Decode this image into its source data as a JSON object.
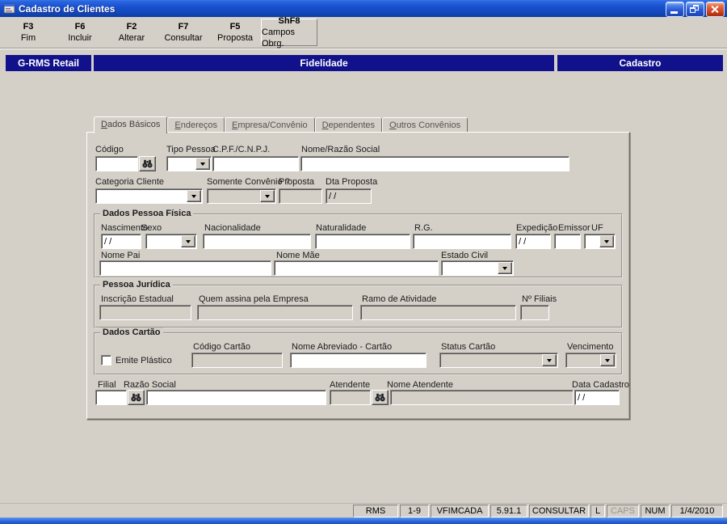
{
  "window": {
    "title": "Cadastro de Clientes"
  },
  "toolbar": {
    "buttons": [
      {
        "key": "F3",
        "label": "Fim"
      },
      {
        "key": "F6",
        "label": "Incluir"
      },
      {
        "key": "F2",
        "label": "Alterar"
      },
      {
        "key": "F7",
        "label": "Consultar"
      },
      {
        "key": "F5",
        "label": "Proposta"
      },
      {
        "key": "ShF8",
        "label": "Campos Obrg."
      }
    ]
  },
  "banner": {
    "left": "G-RMS Retail",
    "center": "Fidelidade",
    "right": "Cadastro"
  },
  "tabs": {
    "items": [
      {
        "label": "Dados Básicos"
      },
      {
        "label": "Endereços"
      },
      {
        "label": "Empresa/Convênio"
      },
      {
        "label": "Dependentes"
      },
      {
        "label": "Outros Convênios"
      }
    ]
  },
  "form": {
    "codigo": {
      "label": "Código",
      "value": ""
    },
    "tipo_pessoa": {
      "label": "Tipo Pessoa",
      "value": ""
    },
    "cpf_cnpj": {
      "label": "C.P.F./C.N.P.J.",
      "value": ""
    },
    "nome_razao_social": {
      "label": "Nome/Razão Social",
      "value": ""
    },
    "categoria_cliente": {
      "label": "Categoria Cliente",
      "value": ""
    },
    "somente_convenio": {
      "label": "Somente Convênio ?",
      "value": ""
    },
    "proposta": {
      "label": "Proposta",
      "value": ""
    },
    "dta_proposta": {
      "label": "Dta Proposta",
      "value": "/ /"
    },
    "pessoa_fisica": {
      "title": "Dados Pessoa Física",
      "nascimento": {
        "label": "Nascimento",
        "value": "/ /"
      },
      "sexo": {
        "label": "Sexo",
        "value": ""
      },
      "nacionalidade": {
        "label": "Nacionalidade",
        "value": ""
      },
      "naturalidade": {
        "label": "Naturalidade",
        "value": ""
      },
      "rg": {
        "label": "R.G.",
        "value": ""
      },
      "expedicao": {
        "label": "Expedição",
        "value": "/ /"
      },
      "emissor": {
        "label": "Emissor",
        "value": ""
      },
      "uf": {
        "label": "UF",
        "value": ""
      },
      "nome_pai": {
        "label": "Nome Pai",
        "value": ""
      },
      "nome_mae": {
        "label": "Nome Mãe",
        "value": ""
      },
      "estado_civil": {
        "label": "Estado Civil",
        "value": ""
      }
    },
    "pessoa_juridica": {
      "title": "Pessoa Jurídica",
      "inscricao_estadual": {
        "label": "Inscrição Estadual",
        "value": ""
      },
      "quem_assina": {
        "label": "Quem assina pela Empresa",
        "value": ""
      },
      "ramo_atividade": {
        "label": "Ramo de Atividade",
        "value": ""
      },
      "num_filiais": {
        "label": "Nº Filiais",
        "value": ""
      }
    },
    "cartao": {
      "title": "Dados Cartão",
      "emite_plastico": {
        "label": "Emite Plástico"
      },
      "codigo_cartao": {
        "label": "Código Cartão",
        "value": ""
      },
      "nome_abreviado": {
        "label": "Nome Abreviado - Cartão",
        "value": ""
      },
      "status_cartao": {
        "label": "Status Cartão",
        "value": ""
      },
      "vencimento": {
        "label": "Vencimento",
        "value": ""
      }
    },
    "rodape": {
      "filial": {
        "label": "Filial",
        "value": ""
      },
      "razao_social": {
        "label": "Razão Social",
        "value": ""
      },
      "atendente": {
        "label": "Atendente",
        "value": ""
      },
      "nome_atendente": {
        "label": "Nome Atendente",
        "value": ""
      },
      "data_cadastro": {
        "label": "Data Cadastro",
        "value": "/ /"
      }
    }
  },
  "statusbar": {
    "cells": [
      {
        "text": "RMS"
      },
      {
        "text": "1-9"
      },
      {
        "text": "VFIMCADA"
      },
      {
        "text": "5.91.1"
      },
      {
        "text": "CONSULTAR"
      },
      {
        "text": "L"
      },
      {
        "text": "CAPS"
      },
      {
        "text": "NUM"
      },
      {
        "text": "1/4/2010"
      }
    ]
  }
}
